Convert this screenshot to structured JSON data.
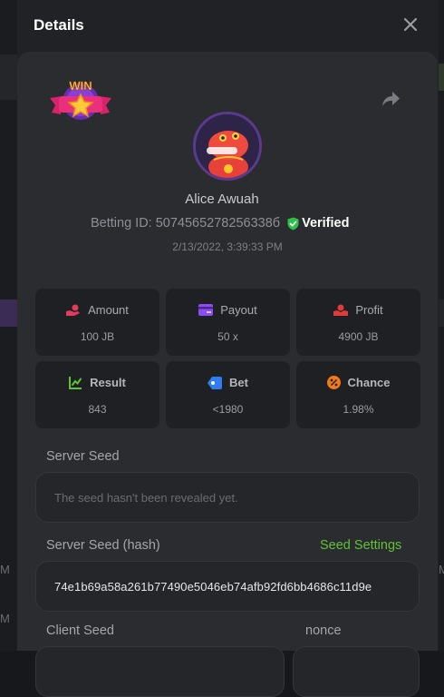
{
  "header": {
    "title": "Details"
  },
  "badge": {
    "text": "WIN"
  },
  "player": {
    "name": "Alice Awuah",
    "betting_id_label": "Betting ID:",
    "betting_id": "5074565278256338б",
    "verified_label": "Verified",
    "datetime": "2/13/2022, 3:39:33 PM"
  },
  "stats": [
    {
      "label": "Amount",
      "value": "100 JB",
      "icon": "hand-coin-icon",
      "color": "#e23b5c"
    },
    {
      "label": "Payout",
      "value": "50 x",
      "icon": "card-icon",
      "color": "#8c4cf0"
    },
    {
      "label": "Profit",
      "value": "4900 JB",
      "icon": "hand-profit-icon",
      "color": "#e23b3b"
    },
    {
      "label": "Result",
      "value": "843",
      "icon": "chart-up-icon",
      "color": "#5fc433"
    },
    {
      "label": "Bet",
      "value": "<1980",
      "icon": "tag-icon",
      "color": "#2f7df0"
    },
    {
      "label": "Chance",
      "value": "1.98%",
      "icon": "percent-icon",
      "color": "#f07a1a"
    }
  ],
  "server_seed": {
    "label": "Server Seed",
    "placeholder": "The seed hasn't been revealed yet."
  },
  "server_seed_hash": {
    "label": "Server Seed (hash)",
    "link": "Seed Settings",
    "value": "74e1b69a58a261b77490e5046eb74afb92fd6bb4686c11d9e"
  },
  "client_seed": {
    "label": "Client Seed"
  },
  "nonce": {
    "label": "nonce"
  },
  "backdrop": {
    "left_letters": [
      "M",
      "M"
    ],
    "right_letters": [
      "M"
    ]
  },
  "colors": {
    "accent_green": "#5fc433",
    "verified_green": "#2fbf4a"
  }
}
